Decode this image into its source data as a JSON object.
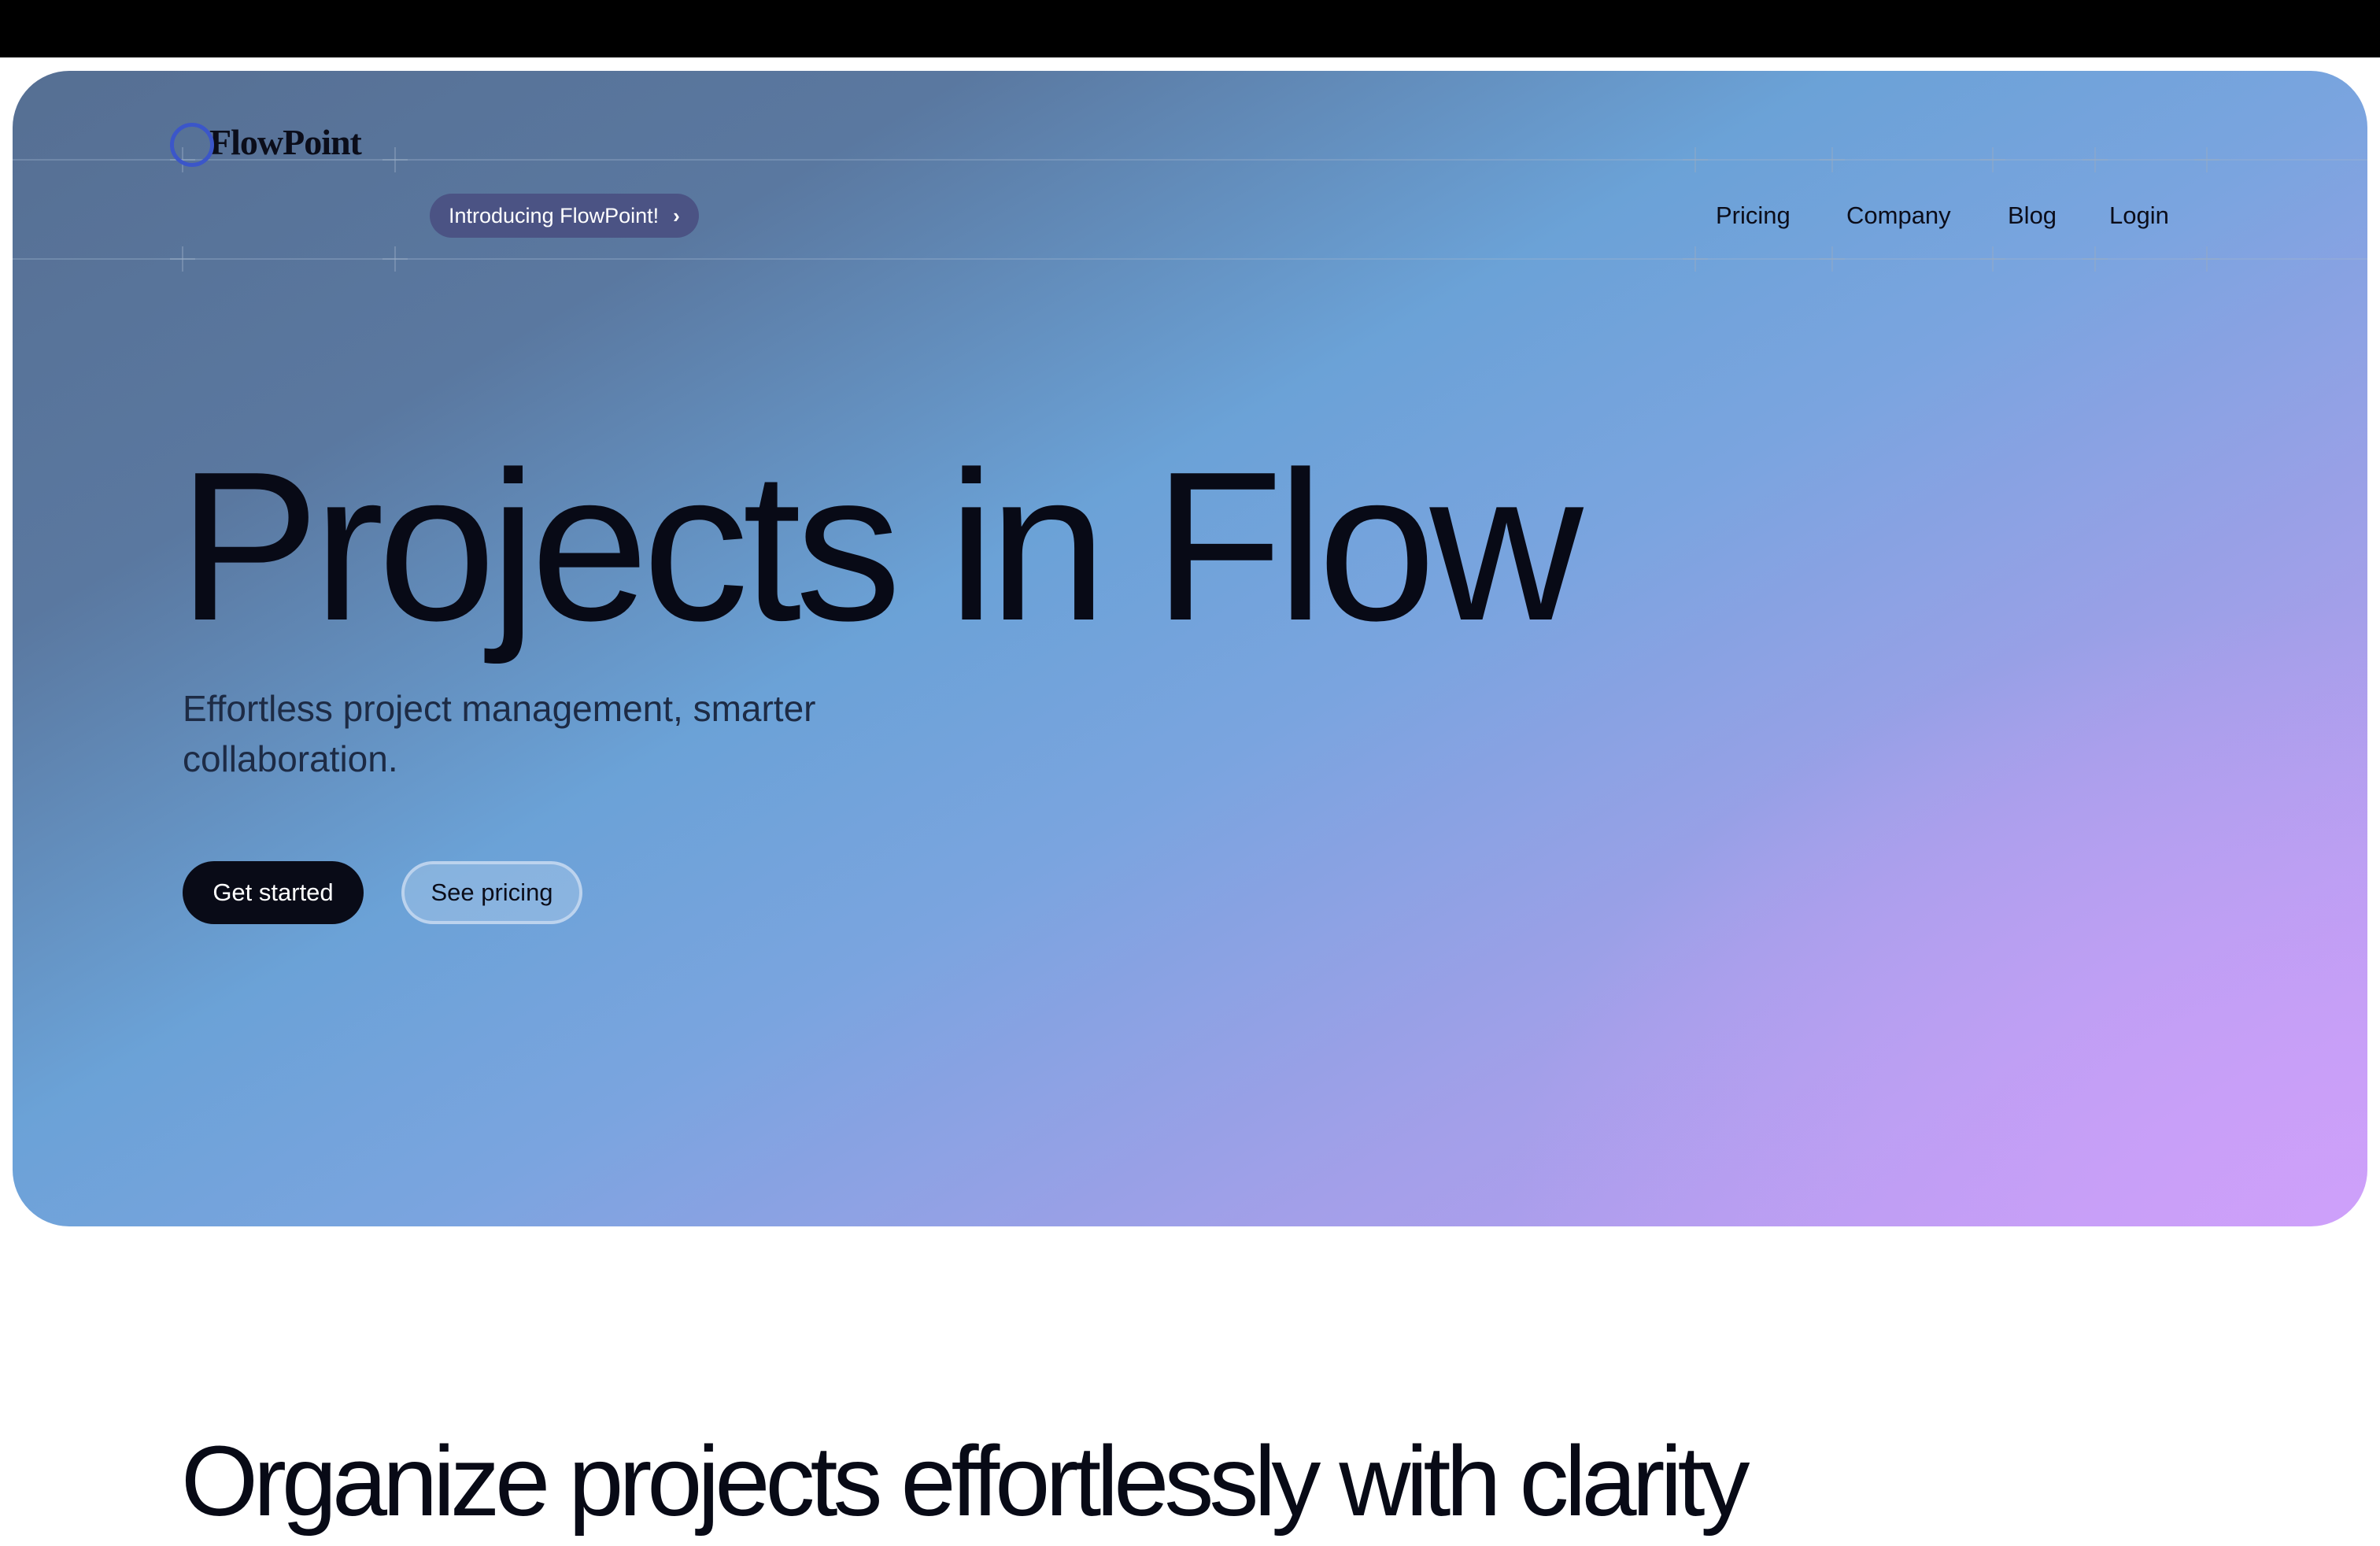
{
  "header": {
    "logo_text": "FlowPoint",
    "intro_badge": "Introducing FlowPoint!",
    "intro_badge_icon": "chevron-right-icon",
    "nav": [
      {
        "label": "Pricing"
      },
      {
        "label": "Company"
      },
      {
        "label": "Blog"
      },
      {
        "label": "Login"
      }
    ]
  },
  "hero": {
    "title": "Projects in Flow",
    "subtitle": "Effortless project management, smarter collaboration.",
    "primary_cta": "Get started",
    "secondary_cta": "See pricing"
  },
  "section": {
    "title": "Organize projects effortlessly with clarity"
  },
  "colors": {
    "hero_gradient_start": "#566f93",
    "hero_gradient_mid": "#6ba2d7",
    "hero_gradient_end": "#c69cf6",
    "primary_button": "#090b17",
    "intro_badge_bg": "#4b5384",
    "logo_accent": "#3b56c9"
  }
}
